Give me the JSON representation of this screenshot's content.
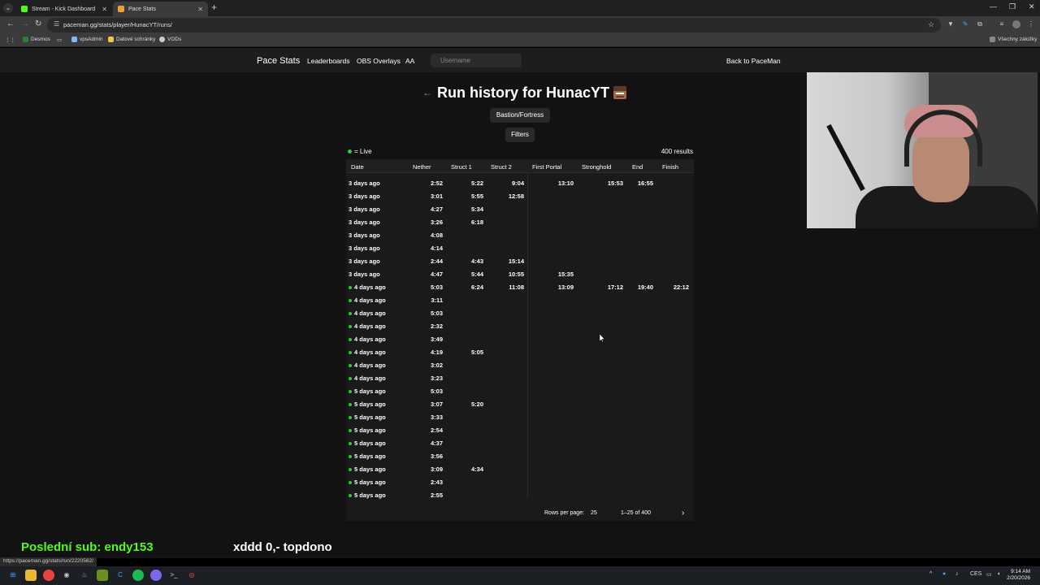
{
  "browser": {
    "tabs": [
      {
        "label": "Stream - Kick Dashboard",
        "color": "#53fc18",
        "active": false
      },
      {
        "label": "Pace Stats",
        "color": "#f0a030",
        "active": true
      }
    ],
    "url": "paceman.gg/stats/player/HunacYT/runs/",
    "bookmarks": [
      "Desmos",
      "vpsAdmin",
      "Datové schránky",
      "VODs"
    ],
    "bookmarks_right": "Všechny záložky"
  },
  "appbar": {
    "brand": "Pace Stats",
    "links": [
      "Leaderboards",
      "OBS Overlays",
      "AA"
    ],
    "username_placeholder": "Username",
    "back": "Back to PaceMan"
  },
  "page": {
    "back_arrow": "←",
    "title": "Run history for HunacYT",
    "category_button": "Bastion/Fortress",
    "filters_button": "Filters",
    "legend": "= Live",
    "results": "400 results"
  },
  "table": {
    "columns": [
      "Date",
      "Nether",
      "Struct 1",
      "Struct 2",
      "First Portal",
      "Stronghold",
      "End",
      "Finish"
    ],
    "rows": [
      {
        "live": false,
        "date": "3 days ago",
        "nether": "2:52",
        "s1": "5:22",
        "s2": "9:04",
        "portal": "13:10",
        "stronghold": "15:53",
        "end": "16:55",
        "finish": ""
      },
      {
        "live": false,
        "date": "3 days ago",
        "nether": "3:01",
        "s1": "5:55",
        "s2": "12:58",
        "portal": "",
        "stronghold": "",
        "end": "",
        "finish": ""
      },
      {
        "live": false,
        "date": "3 days ago",
        "nether": "4:27",
        "s1": "5:34",
        "s2": "",
        "portal": "",
        "stronghold": "",
        "end": "",
        "finish": ""
      },
      {
        "live": false,
        "date": "3 days ago",
        "nether": "3:26",
        "s1": "6:18",
        "s2": "",
        "portal": "",
        "stronghold": "",
        "end": "",
        "finish": ""
      },
      {
        "live": false,
        "date": "3 days ago",
        "nether": "4:08",
        "s1": "",
        "s2": "",
        "portal": "",
        "stronghold": "",
        "end": "",
        "finish": ""
      },
      {
        "live": false,
        "date": "3 days ago",
        "nether": "4:14",
        "s1": "",
        "s2": "",
        "portal": "",
        "stronghold": "",
        "end": "",
        "finish": ""
      },
      {
        "live": false,
        "date": "3 days ago",
        "nether": "2:44",
        "s1": "4:43",
        "s2": "15:14",
        "portal": "",
        "stronghold": "",
        "end": "",
        "finish": ""
      },
      {
        "live": false,
        "date": "3 days ago",
        "nether": "4:47",
        "s1": "5:44",
        "s2": "10:55",
        "portal": "15:35",
        "stronghold": "",
        "end": "",
        "finish": ""
      },
      {
        "live": true,
        "date": "4 days ago",
        "nether": "5:03",
        "s1": "6:24",
        "s2": "11:08",
        "portal": "13:09",
        "stronghold": "17:12",
        "end": "19:40",
        "finish": "22:12"
      },
      {
        "live": true,
        "date": "4 days ago",
        "nether": "3:11",
        "s1": "",
        "s2": "",
        "portal": "",
        "stronghold": "",
        "end": "",
        "finish": ""
      },
      {
        "live": true,
        "date": "4 days ago",
        "nether": "5:03",
        "s1": "",
        "s2": "",
        "portal": "",
        "stronghold": "",
        "end": "",
        "finish": ""
      },
      {
        "live": true,
        "date": "4 days ago",
        "nether": "2:32",
        "s1": "",
        "s2": "",
        "portal": "",
        "stronghold": "",
        "end": "",
        "finish": ""
      },
      {
        "live": true,
        "date": "4 days ago",
        "nether": "3:49",
        "s1": "",
        "s2": "",
        "portal": "",
        "stronghold": "",
        "end": "",
        "finish": ""
      },
      {
        "live": true,
        "date": "4 days ago",
        "nether": "4:19",
        "s1": "5:05",
        "s2": "",
        "portal": "",
        "stronghold": "",
        "end": "",
        "finish": ""
      },
      {
        "live": true,
        "date": "4 days ago",
        "nether": "3:02",
        "s1": "",
        "s2": "",
        "portal": "",
        "stronghold": "",
        "end": "",
        "finish": ""
      },
      {
        "live": true,
        "date": "4 days ago",
        "nether": "3:23",
        "s1": "",
        "s2": "",
        "portal": "",
        "stronghold": "",
        "end": "",
        "finish": ""
      },
      {
        "live": true,
        "date": "5 days ago",
        "nether": "5:03",
        "s1": "",
        "s2": "",
        "portal": "",
        "stronghold": "",
        "end": "",
        "finish": ""
      },
      {
        "live": true,
        "date": "5 days ago",
        "nether": "3:07",
        "s1": "5:20",
        "s2": "",
        "portal": "",
        "stronghold": "",
        "end": "",
        "finish": ""
      },
      {
        "live": true,
        "date": "5 days ago",
        "nether": "3:33",
        "s1": "",
        "s2": "",
        "portal": "",
        "stronghold": "",
        "end": "",
        "finish": ""
      },
      {
        "live": true,
        "date": "5 days ago",
        "nether": "2:54",
        "s1": "",
        "s2": "",
        "portal": "",
        "stronghold": "",
        "end": "",
        "finish": ""
      },
      {
        "live": true,
        "date": "5 days ago",
        "nether": "4:37",
        "s1": "",
        "s2": "",
        "portal": "",
        "stronghold": "",
        "end": "",
        "finish": ""
      },
      {
        "live": true,
        "date": "5 days ago",
        "nether": "3:56",
        "s1": "",
        "s2": "",
        "portal": "",
        "stronghold": "",
        "end": "",
        "finish": ""
      },
      {
        "live": true,
        "date": "5 days ago",
        "nether": "3:09",
        "s1": "4:34",
        "s2": "",
        "portal": "",
        "stronghold": "",
        "end": "",
        "finish": ""
      },
      {
        "live": true,
        "date": "5 days ago",
        "nether": "2:43",
        "s1": "",
        "s2": "",
        "portal": "",
        "stronghold": "",
        "end": "",
        "finish": ""
      },
      {
        "live": true,
        "date": "5 days ago",
        "nether": "2:55",
        "s1": "",
        "s2": "",
        "portal": "",
        "stronghold": "",
        "end": "",
        "finish": ""
      }
    ],
    "footer": {
      "rows_per_page_label": "Rows per page:",
      "rows_per_page_value": "25",
      "range": "1–25 of 400",
      "next": "›"
    }
  },
  "stream_overlay": {
    "last_sub": "Poslední sub: endy153",
    "last_sub_color": "#53fc18",
    "message": "xddd 0,- topdono",
    "message_color": "#ffffff"
  },
  "status_url": "https://paceman.gg/stats/run/2220562/",
  "taskbar": {
    "language": "CES",
    "time": "9:14 AM",
    "date": "2/20/2026"
  }
}
